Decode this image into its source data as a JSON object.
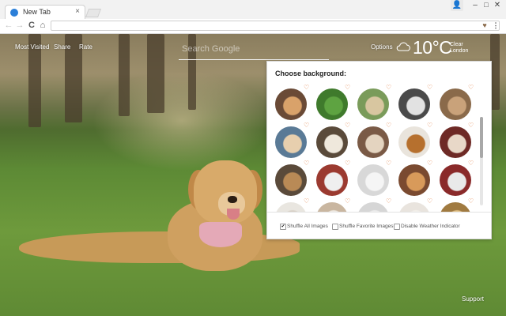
{
  "browser": {
    "tab_title": "New Tab",
    "tab_close_glyph": "×",
    "profile_glyph": "👤",
    "minimize_glyph": "–",
    "maximize_glyph": "□",
    "close_glyph": "✕",
    "back_glyph": "←",
    "forward_glyph": "→",
    "reload_glyph": "C",
    "home_glyph": "⌂",
    "extension_glyph": "♥",
    "menu_glyph": "⋮",
    "address_value": ""
  },
  "page": {
    "nav_links": [
      "Most Visited",
      "Share",
      "Rate"
    ],
    "search_placeholder": "Search Google",
    "options_label": "Options",
    "weather": {
      "temperature": "10°C",
      "condition_line1": "Clear",
      "condition_line2": "London",
      "icon": "cloud-icon"
    },
    "support_label": "Support"
  },
  "panel": {
    "title": "Choose background:",
    "favorite_glyph": "♡",
    "thumbnails": [
      {
        "name": "thumb-dog-1",
        "bg": "#6a4a36",
        "fg": "#d9a26a"
      },
      {
        "name": "thumb-dog-2",
        "bg": "#3f7a2c",
        "fg": "#5ea341"
      },
      {
        "name": "thumb-dog-3",
        "bg": "#7a9b5a",
        "fg": "#d8c6a0"
      },
      {
        "name": "thumb-dog-4",
        "bg": "#4a4a4a",
        "fg": "#e2e2e2"
      },
      {
        "name": "thumb-dog-5",
        "bg": "#8a6a4a",
        "fg": "#c9a27a"
      },
      {
        "name": "thumb-dog-6",
        "bg": "#5a7a96",
        "fg": "#e7cfae"
      },
      {
        "name": "thumb-dog-7",
        "bg": "#5a4a3a",
        "fg": "#efe8dc"
      },
      {
        "name": "thumb-dog-8",
        "bg": "#7a5a46",
        "fg": "#e4d4c0"
      },
      {
        "name": "thumb-dog-9",
        "bg": "#e9e4dc",
        "fg": "#b6702e"
      },
      {
        "name": "thumb-dog-10",
        "bg": "#6e2a26",
        "fg": "#e8d8c8"
      },
      {
        "name": "thumb-dog-11",
        "bg": "#5a4a3a",
        "fg": "#b98a56"
      },
      {
        "name": "thumb-dog-12",
        "bg": "#9b3a30",
        "fg": "#efefef"
      },
      {
        "name": "thumb-dog-13",
        "bg": "#d8d8d8",
        "fg": "#f5f5f5"
      },
      {
        "name": "thumb-dog-14",
        "bg": "#7a4a30",
        "fg": "#d89a5a"
      },
      {
        "name": "thumb-dog-15",
        "bg": "#8a2a2a",
        "fg": "#e9e9e9"
      },
      {
        "name": "thumb-dog-16",
        "bg": "#e9e6e0",
        "fg": "#d8d0c6"
      },
      {
        "name": "thumb-dog-17",
        "bg": "#c9b6a0",
        "fg": "#f0ebe4"
      },
      {
        "name": "thumb-dog-18",
        "bg": "#d6d6d6",
        "fg": "#efefef"
      },
      {
        "name": "thumb-dog-19",
        "bg": "#e9e4de",
        "fg": "#f4f1ec"
      },
      {
        "name": "thumb-dog-20",
        "bg": "#a07a40",
        "fg": "#e3c48c"
      }
    ],
    "options": [
      {
        "label": "Shuffle All Images",
        "checked": true
      },
      {
        "label": "Shuffle Favorite Images",
        "checked": false
      },
      {
        "label": "Disable Weather Indicator",
        "checked": false
      }
    ],
    "check_glyph": "✔"
  },
  "colors": {
    "favorite_heart": "#e27a3d",
    "favicon_blue": "#2b7fd8"
  }
}
